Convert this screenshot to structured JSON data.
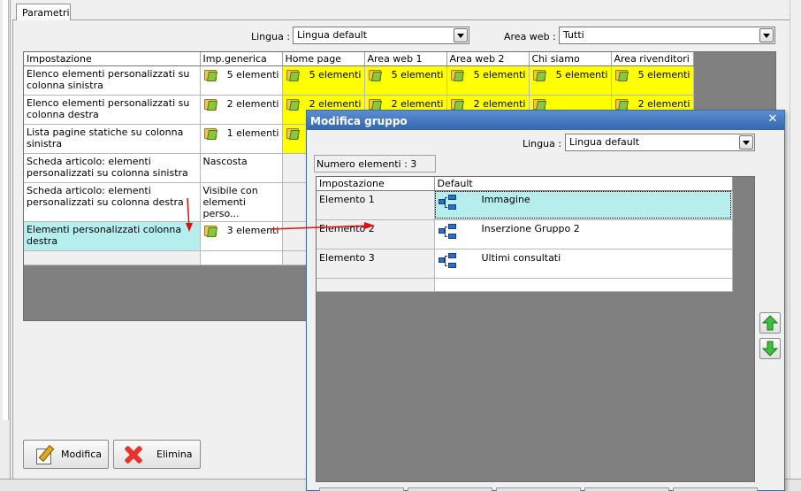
{
  "tab": {
    "label": "Parametri"
  },
  "filters": {
    "lingua_label": "Lingua :",
    "lingua_value": "Lingua default",
    "area_label": "Area web :",
    "area_value": "Tutti"
  },
  "main_grid": {
    "headers": [
      "Impostazione",
      "Imp.generica",
      "Home page",
      "Area web 1",
      "Area web 2",
      "Chi siamo",
      "Area rivenditori"
    ],
    "rows": [
      {
        "setting": "Elenco elementi personalizzati su colonna sinistra",
        "generic": "5 elementi",
        "areas": [
          "5 elementi",
          "5 elementi",
          "5 elementi",
          "5 elementi",
          "5 elementi"
        ]
      },
      {
        "setting": "Elenco elementi personalizzati su colonna destra",
        "generic": "2 elementi",
        "areas": [
          "2 elementi",
          "2 elementi",
          "2 elementi",
          "",
          "2 elementi"
        ]
      },
      {
        "setting": "Lista pagine statiche su colonna sinistra",
        "generic": "1 elementi"
      },
      {
        "setting": "Scheda articolo: elementi personalizzati su colonna sinistra",
        "generic": "Nascosta"
      },
      {
        "setting": "Scheda articolo: elementi personalizzati su colonna destra",
        "generic": "Visibile con elementi perso..."
      },
      {
        "setting": "Elementi personalizzati colonna destra",
        "generic": "3 elementi"
      }
    ]
  },
  "buttons": {
    "modifica": "Modifica",
    "elimina": "Elimina"
  },
  "dialog": {
    "title": "Modifica gruppo",
    "lingua_label": "Lingua :",
    "lingua_value": "Lingua default",
    "count_label": "Numero elementi : 3",
    "headers": [
      "Impostazione",
      "Default"
    ],
    "rows": [
      {
        "setting": "Elemento 1",
        "value": "Immagine"
      },
      {
        "setting": "Elemento 2",
        "value": "Inserzione Gruppo 2"
      },
      {
        "setting": "Elemento 3",
        "value": "Ultimi consultati"
      }
    ]
  },
  "colors": {
    "highlight_yellow": "#ffff00",
    "selected_cyan": "#b6eeee",
    "dialog_title": "#3566b2",
    "annotation_red": "#e01010"
  },
  "icons": [
    "folder-icon",
    "tree-icon",
    "pencil-icon",
    "delete-x-icon",
    "arrow-up-icon",
    "arrow-down-icon",
    "close-icon",
    "chevron-down-icon"
  ]
}
